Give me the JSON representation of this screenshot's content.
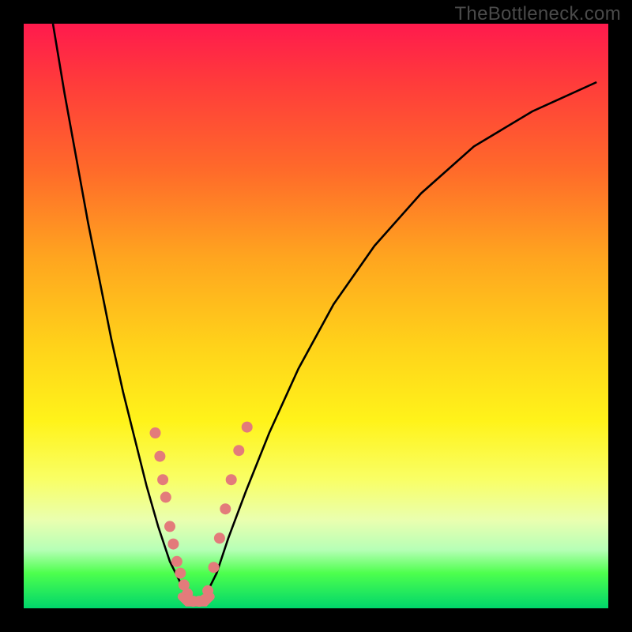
{
  "watermark": "TheBottleneck.com",
  "chart_data": {
    "type": "line",
    "title": "",
    "xlabel": "",
    "ylabel": "",
    "xlim": [
      0,
      100
    ],
    "ylim": [
      0,
      100
    ],
    "series": [
      {
        "name": "left-curve",
        "x": [
          5,
          7,
          9,
          11,
          13,
          15,
          17,
          19,
          21,
          23,
          24,
          25,
          26,
          27,
          28
        ],
        "y": [
          100,
          88,
          77,
          66,
          56,
          46,
          37,
          29,
          21,
          14,
          11,
          8,
          6,
          4,
          2
        ]
      },
      {
        "name": "right-curve",
        "x": [
          31,
          33,
          35,
          38,
          42,
          47,
          53,
          60,
          68,
          77,
          87,
          98
        ],
        "y": [
          2,
          6,
          12,
          20,
          30,
          41,
          52,
          62,
          71,
          79,
          85,
          90
        ]
      },
      {
        "name": "valley-floor",
        "x": [
          27,
          28,
          29,
          30,
          31,
          32
        ],
        "y": [
          2,
          1,
          1,
          1,
          1,
          2
        ]
      }
    ],
    "dots_left": [
      {
        "x": 22.5,
        "y": 30
      },
      {
        "x": 23.3,
        "y": 26
      },
      {
        "x": 23.8,
        "y": 22
      },
      {
        "x": 24.3,
        "y": 19
      },
      {
        "x": 25.0,
        "y": 14
      },
      {
        "x": 25.6,
        "y": 11
      },
      {
        "x": 26.2,
        "y": 8
      },
      {
        "x": 26.8,
        "y": 6
      },
      {
        "x": 27.4,
        "y": 4
      },
      {
        "x": 28.0,
        "y": 2.5
      }
    ],
    "dots_right": [
      {
        "x": 31.5,
        "y": 3
      },
      {
        "x": 32.5,
        "y": 7
      },
      {
        "x": 33.5,
        "y": 12
      },
      {
        "x": 34.5,
        "y": 17
      },
      {
        "x": 35.5,
        "y": 22
      },
      {
        "x": 36.8,
        "y": 27
      },
      {
        "x": 38.2,
        "y": 31
      }
    ],
    "dots_bottom": [
      {
        "x": 28.0,
        "y": 1.5
      },
      {
        "x": 29.0,
        "y": 1.2
      },
      {
        "x": 30.0,
        "y": 1.2
      },
      {
        "x": 31.0,
        "y": 1.5
      }
    ],
    "dot_color": "#e37b7b",
    "curve_color": "#000000"
  }
}
